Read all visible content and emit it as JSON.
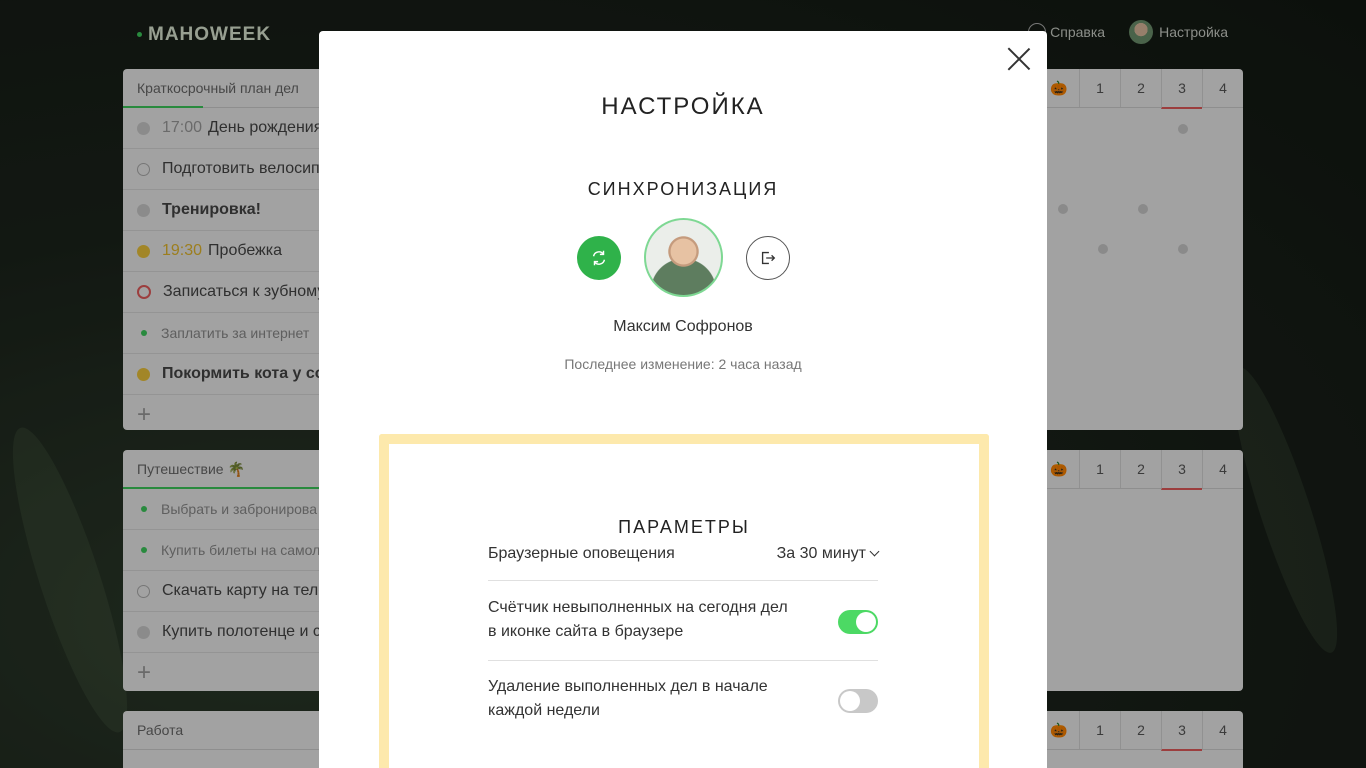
{
  "app": {
    "logo": "MAHOWEEK"
  },
  "topnav": {
    "help_label": "Справка",
    "settings_label": "Настройка"
  },
  "lists": [
    {
      "title": "Краткосрочный план дел",
      "tasks": [
        {
          "time": "17:00",
          "text": "День рождения"
        },
        {
          "time": "",
          "text": "Подготовить велосип"
        },
        {
          "time": "",
          "text": "Тренировка!"
        },
        {
          "time": "19:30",
          "text": "Пробежка"
        },
        {
          "time": "",
          "text": "Записаться к зубному"
        },
        {
          "time": "",
          "text": "Заплатить за интернет"
        },
        {
          "time": "",
          "text": "Покормить кота у со"
        }
      ],
      "days": [
        "1",
        "2",
        "3",
        "4"
      ]
    },
    {
      "title": "Путешествие 🌴",
      "tasks": [
        {
          "text": "Выбрать и забронирова"
        },
        {
          "text": "Купить билеты на самол"
        },
        {
          "text": "Скачать карту на теле"
        },
        {
          "text": "Купить полотенце и с"
        }
      ],
      "days": [
        "1",
        "2",
        "3",
        "4"
      ]
    },
    {
      "title": "Работа",
      "days": [
        "1",
        "2",
        "3",
        "4"
      ]
    }
  ],
  "modal": {
    "title": "НАСТРОЙКА",
    "sync_title": "СИНХРОНИЗАЦИЯ",
    "user_name": "Максим Софронов",
    "last_change": "Последнее изменение: 2 часа назад",
    "params_title": "ПАРАМЕТРЫ",
    "params": [
      {
        "label": "Браузерные оповещения",
        "value": "За 30 минут"
      },
      {
        "label_line1": "Счётчик невыполненных на сегодня дел",
        "label_line2": "в иконке сайта в браузере",
        "state": "on"
      },
      {
        "label_line1": "Удаление выполненных дел в начале",
        "label_line2": "каждой недели",
        "state": "off"
      }
    ]
  },
  "colors": {
    "accent_green": "#2fb24a",
    "toggle_on": "#4cd964",
    "params_border": "#fde9ac"
  }
}
